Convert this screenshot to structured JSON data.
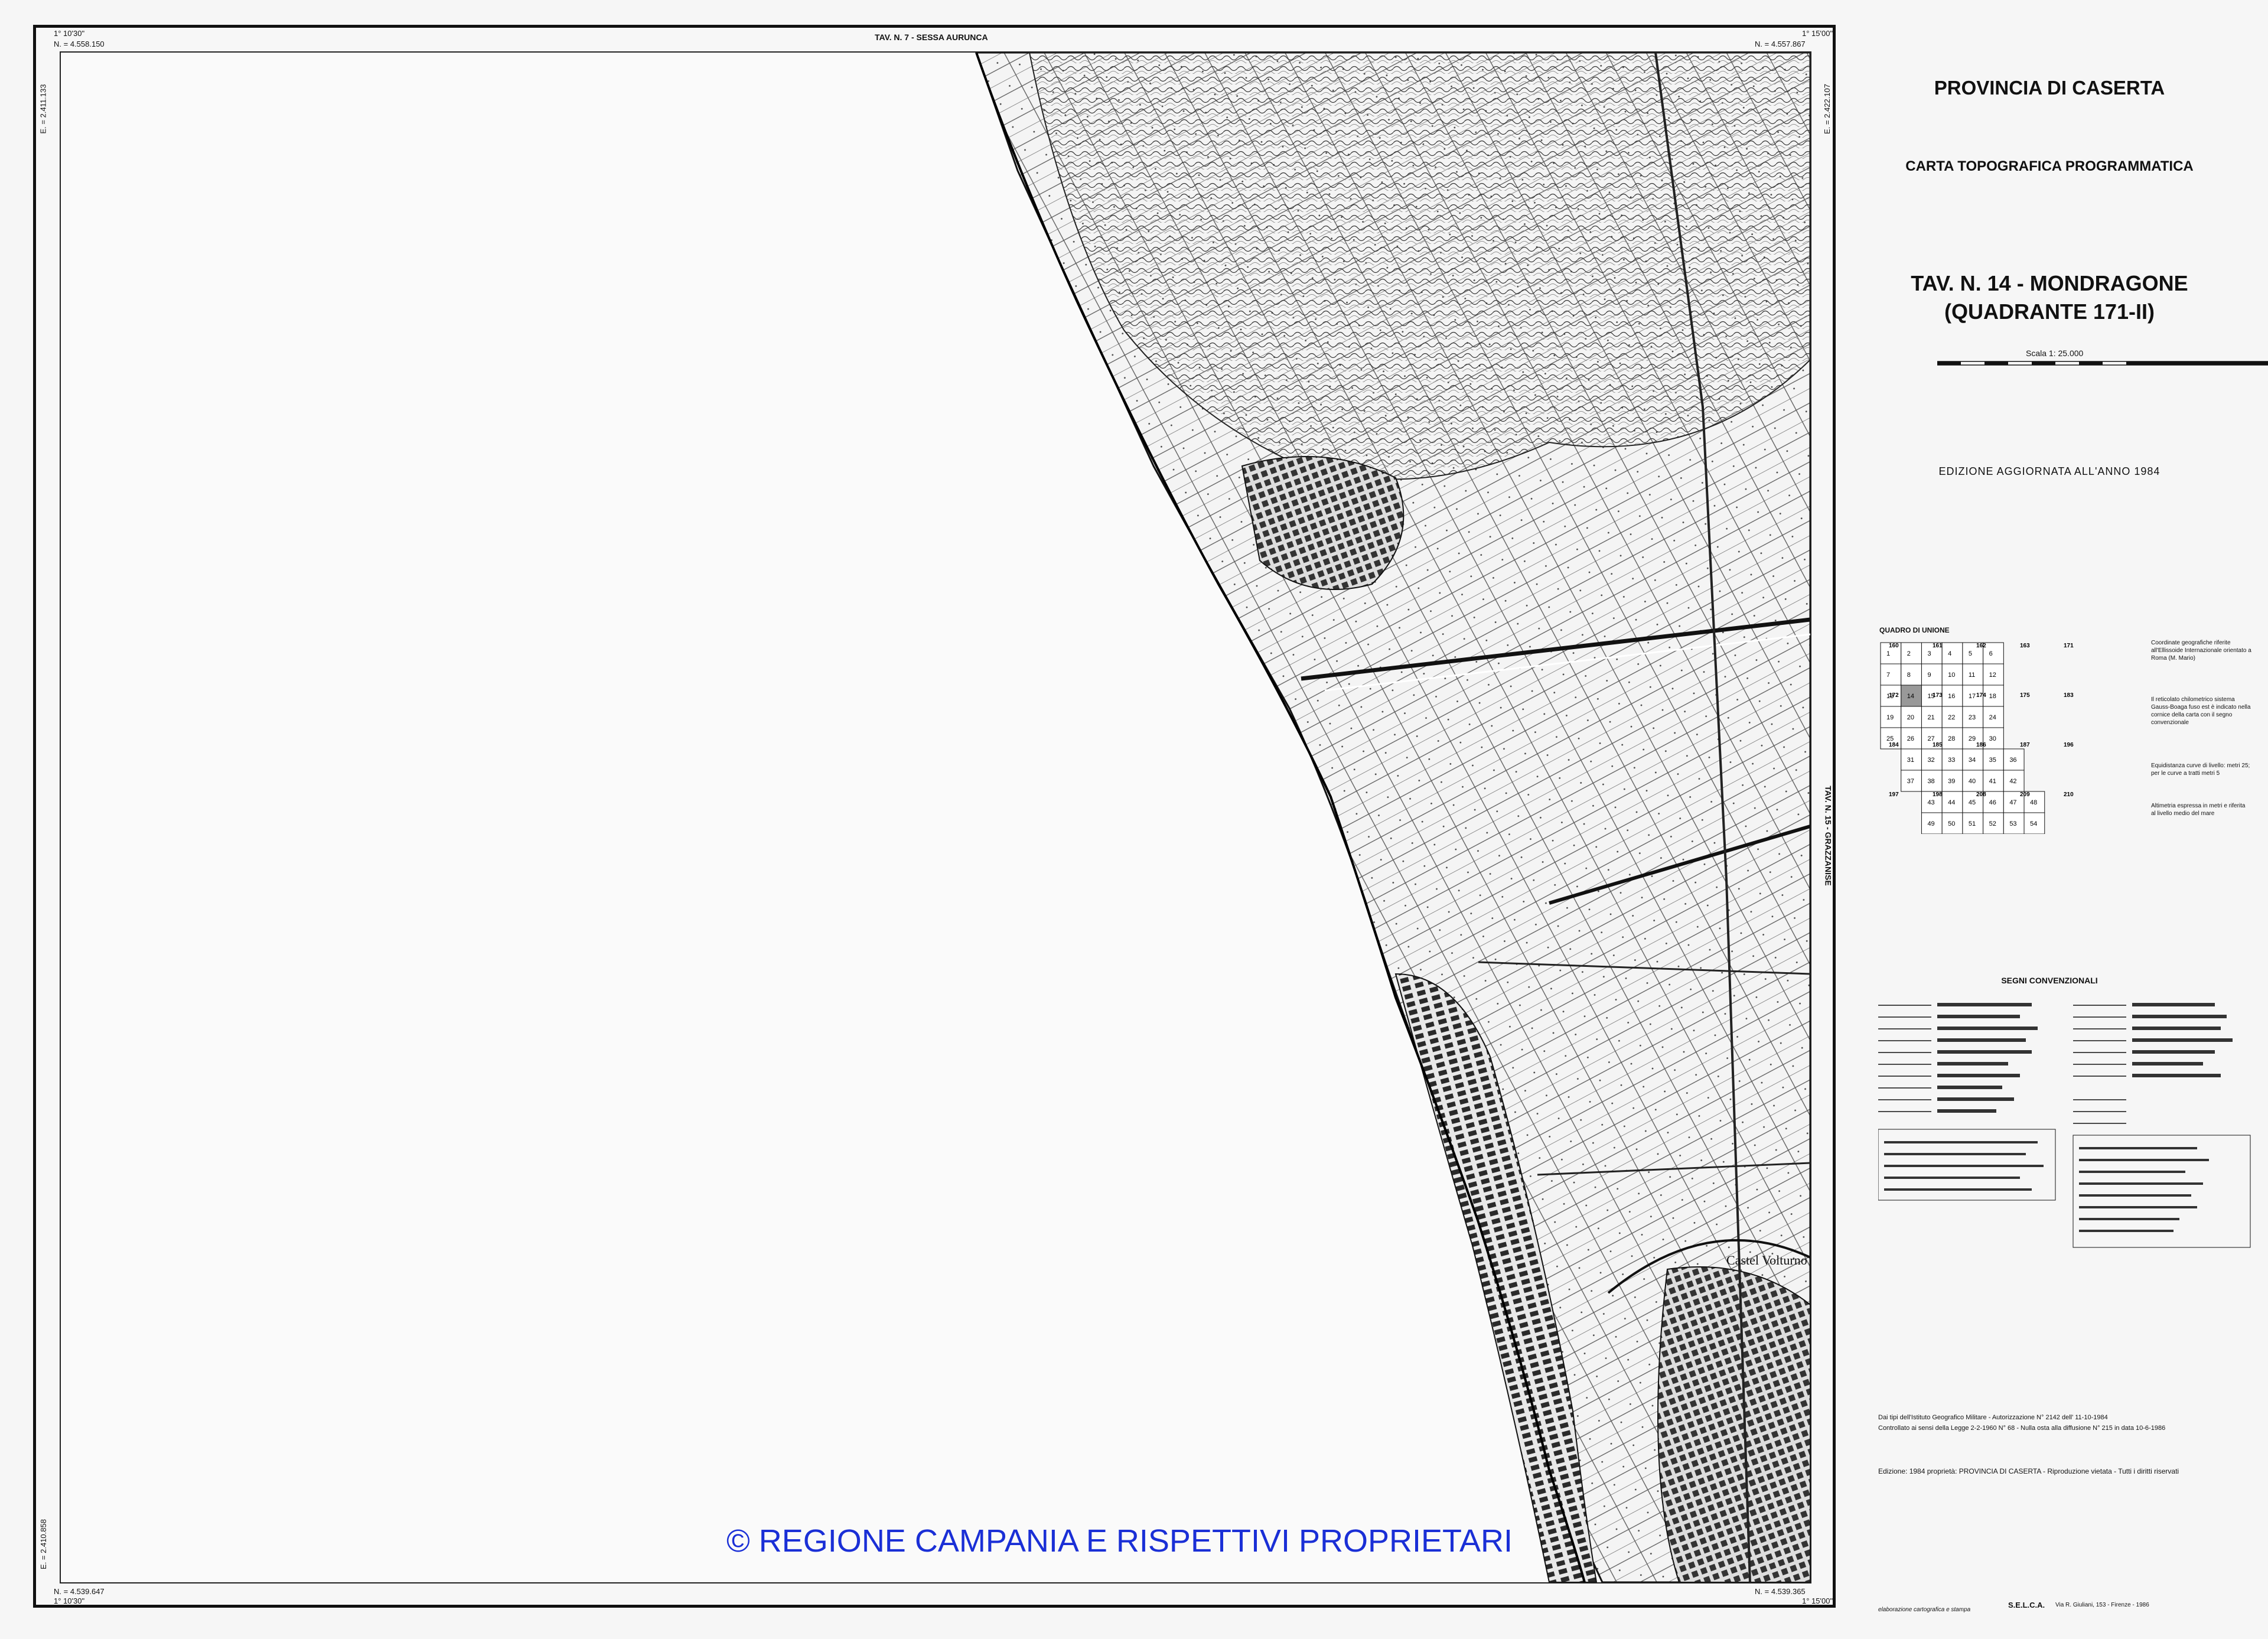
{
  "map": {
    "edge_top": "TAV. N. 7 - SESSA AURUNCA",
    "edge_right": "TAV. N. 15 - GRAZZANISE",
    "coord_top_left": "N. = 4.558.150",
    "coord_top_right": "N. = 4.557.867",
    "coord_bottom_left": "N. = 4.539.647",
    "coord_bottom_right": "N. = 4.539.365",
    "coord_left_top": "E. = 2.411.133",
    "coord_left_bottom": "E. = 2.410.858",
    "coord_right_top": "E. = 2.422.107",
    "coord_corner_tl": "1° 10'30\"",
    "coord_corner_tr": "1° 15'00\"",
    "coord_corner_bl": "1° 10'30\"",
    "coord_corner_br": "1° 15'00\"",
    "place_castel_volturno": "Castel Volturno",
    "copyright": "© REGIONE CAMPANIA E RISPETTIVI PROPRIETARI"
  },
  "legend": {
    "province": "PROVINCIA DI CASERTA",
    "subtitle": "CARTA TOPOGRAFICA PROGRAMMATICA",
    "tav_line1": "TAV. N. 14 - MONDRAGONE",
    "tav_line2": "(QUADRANTE 171-II)",
    "scale": "Scala 1: 25.000",
    "edition": "EDIZIONE AGGIORNATA ALL'ANNO 1984",
    "quadro_title": "QUADRO DI UNIONE",
    "quadro_cells": [
      "1",
      "2",
      "3",
      "4",
      "5",
      "6",
      "7",
      "8",
      "9",
      "10",
      "11",
      "12",
      "13",
      "14",
      "15",
      "16",
      "17",
      "18",
      "19",
      "20",
      "21",
      "22",
      "23",
      "24",
      "25",
      "26",
      "27",
      "28",
      "29",
      "30",
      "31",
      "32",
      "33",
      "34",
      "35",
      "36",
      "37",
      "38",
      "39",
      "40",
      "41",
      "42",
      "43",
      "44",
      "45",
      "46",
      "47",
      "48",
      "49",
      "50",
      "51",
      "52",
      "53",
      "54"
    ],
    "quadro_sheets": [
      "160",
      "161",
      "162",
      "163",
      "171",
      "172",
      "173",
      "174",
      "175",
      "183",
      "184",
      "185",
      "186",
      "187",
      "196",
      "197",
      "198",
      "208",
      "209",
      "210"
    ],
    "note_1": "Coordinate geografiche riferite all'Ellissoide Internazionale orientato a Roma (M. Mario)",
    "note_2": "Il reticolato chilometrico sistema Gauss-Boaga fuso est è indicato nella cornice della carta con il segno convenzionale",
    "note_3": "Equidistanza curve di livello: metri 25; per le curve a tratti metri 5",
    "note_4": "Altimetria espressa in metri e riferita al livello medio del mare",
    "segni_title": "SEGNI CONVENZIONALI",
    "credit_1": "Dai tipi dell'Istituto Geografico Militare - Autorizzazione N° 2142 dell' 11-10-1984",
    "credit_2": "Controllato ai sensi della Legge 2-2-1960 N° 68 - Nulla osta alla diffusione N° 215 in data 10-6-1986",
    "footer": "Edizione: 1984 proprietà: PROVINCIA DI CASERTA - Riproduzione vietata - Tutti i diritti riservati",
    "elab": "elaborazione cartografica e stampa",
    "selca": "S.E.L.C.A.",
    "selca_addr": "Via R. Giuliani, 153 - Firenze - 1986"
  }
}
